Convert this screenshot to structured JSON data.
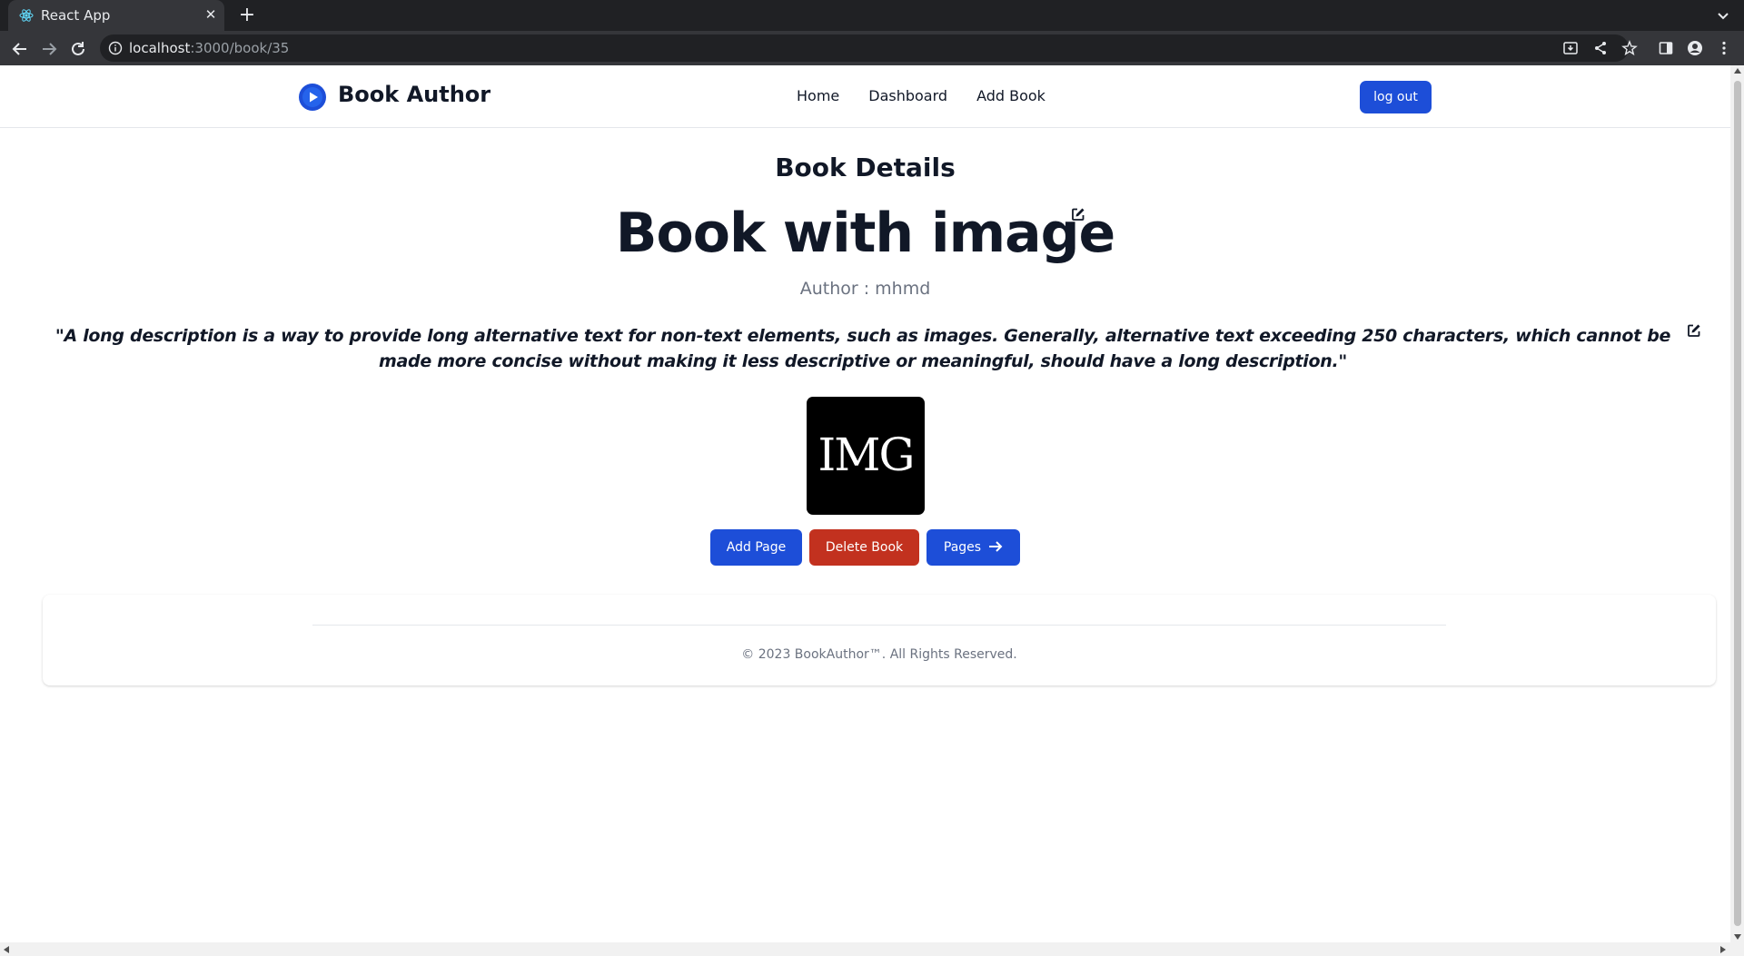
{
  "browser": {
    "tab_title": "React App",
    "tab_close": "✕",
    "new_tab": "+",
    "url_host": "localhost",
    "url_path": ":3000/book/35"
  },
  "navbar": {
    "brand": "Book Author",
    "links": [
      "Home",
      "Dashboard",
      "Add Book"
    ],
    "logout_label": "log out"
  },
  "book": {
    "section_title": "Book Details",
    "title": "Book with image",
    "author_line": "Author : mhmd",
    "description": "\"A long description is a way to provide long alternative text for non-text elements, such as images. Generally, alternative text exceeding 250 characters, which cannot be made more concise without making it less descriptive or meaningful, should have a long description.\"",
    "image_text": "IMG"
  },
  "actions": {
    "add_page": "Add Page",
    "delete_book": "Delete Book",
    "pages": "Pages"
  },
  "footer": {
    "copyright": "© 2023 BookAuthor™. All Rights Reserved."
  },
  "colors": {
    "primary": "#1d4ed8",
    "danger": "#c2311f",
    "text": "#111827",
    "muted": "#6b7280"
  },
  "icons": {
    "brand": "play-circle-icon",
    "edit": "edit-square-icon",
    "pages_arrow": "arrow-right-icon"
  }
}
